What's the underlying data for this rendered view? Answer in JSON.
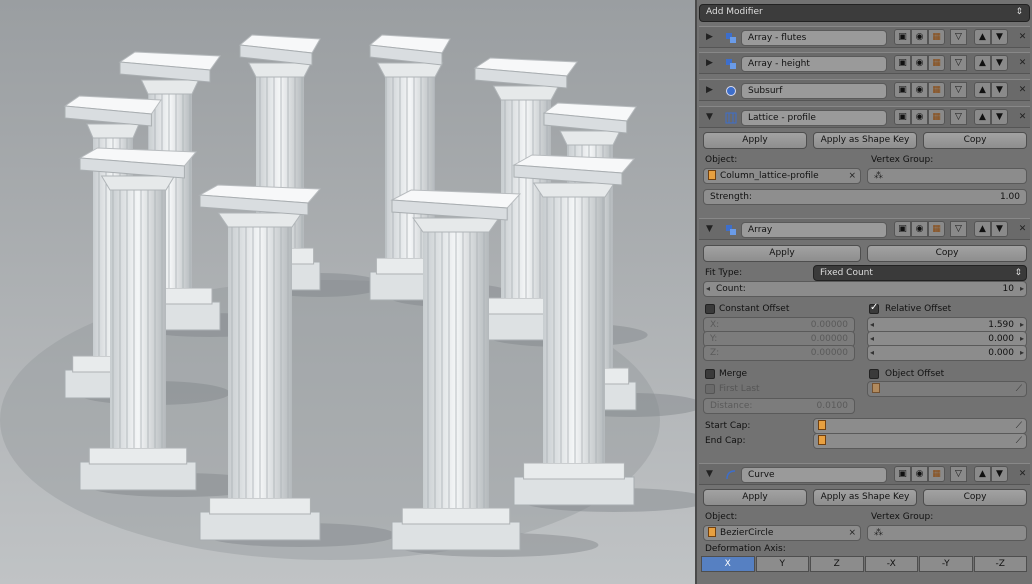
{
  "header": {
    "add_modifier": "Add Modifier",
    "arrow": "⇕"
  },
  "modifiers": [
    {
      "name": "Array - flutes"
    },
    {
      "name": "Array - height"
    },
    {
      "name": "Subsurf"
    },
    {
      "name": "Lattice - profile"
    },
    {
      "name": "Array"
    },
    {
      "name": "Curve"
    }
  ],
  "lattice": {
    "apply": "Apply",
    "apply_shape": "Apply as Shape Key",
    "copy": "Copy",
    "object_label": "Object:",
    "object_value": "Column_lattice-profile",
    "vgroup_label": "Vertex Group:",
    "strength_label": "Strength:",
    "strength_value": "1.00"
  },
  "array": {
    "apply": "Apply",
    "copy": "Copy",
    "fit_label": "Fit Type:",
    "fit_value": "Fixed Count",
    "count_label": "Count:",
    "count_value": "10",
    "constant_offset": "Constant Offset",
    "relative_offset": "Relative Offset",
    "const": [
      {
        "label": "X:",
        "value": "0.00000"
      },
      {
        "label": "Y:",
        "value": "0.00000"
      },
      {
        "label": "Z:",
        "value": "0.00000"
      }
    ],
    "rel": [
      "1.590",
      "0.000",
      "0.000"
    ],
    "merge": "Merge",
    "first_last": "First Last",
    "object_offset": "Object Offset",
    "distance_label": "Distance:",
    "distance_value": "0.0100",
    "start_cap": "Start Cap:",
    "end_cap": "End Cap:"
  },
  "curve": {
    "apply": "Apply",
    "apply_shape": "Apply as Shape Key",
    "copy": "Copy",
    "object_label": "Object:",
    "object_value": "BezierCircle",
    "vgroup_label": "Vertex Group:",
    "deform_label": "Deformation Axis:",
    "axes": [
      "X",
      "Y",
      "Z",
      "-X",
      "-Y",
      "-Z"
    ],
    "active_axis": "X"
  },
  "colors": {
    "panel": "#727272",
    "active_axis": "#5680c2",
    "field": "#8c8c8c",
    "dark_field": "#3a3a3a"
  },
  "icons": [
    "triangle-right-icon",
    "triangle-down-icon",
    "array-icon",
    "subsurf-icon",
    "lattice-icon",
    "curve-icon",
    "editmode-icon",
    "eye-icon",
    "render-icon",
    "cage-icon",
    "up-icon",
    "down-icon",
    "close-icon",
    "object-cube-icon",
    "eyedropper-icon",
    "vertex-group-icon"
  ]
}
